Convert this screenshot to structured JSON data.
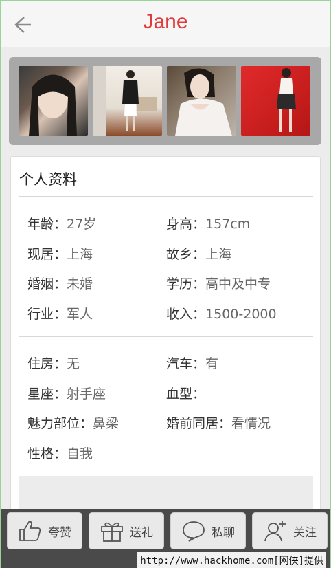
{
  "header": {
    "title": "Jane",
    "back_icon": "back-arrow-icon",
    "accent_color": "#e03a3a"
  },
  "photos": [
    {
      "name": "photo-1"
    },
    {
      "name": "photo-2"
    },
    {
      "name": "photo-3"
    },
    {
      "name": "photo-4"
    }
  ],
  "profile": {
    "section_title": "个人资料",
    "group1": [
      {
        "label": "年龄：",
        "value": "27岁"
      },
      {
        "label": "身高：",
        "value": "157cm"
      },
      {
        "label": "现居：",
        "value": "上海"
      },
      {
        "label": "故乡：",
        "value": "上海"
      },
      {
        "label": "婚姻：",
        "value": "未婚"
      },
      {
        "label": "学历：",
        "value": "高中及中专"
      },
      {
        "label": "行业：",
        "value": "军人"
      },
      {
        "label": "收入：",
        "value": "1500-2000"
      }
    ],
    "group2": [
      {
        "label": "住房：",
        "value": "无"
      },
      {
        "label": "汽车：",
        "value": "有"
      },
      {
        "label": "星座：",
        "value": "射手座"
      },
      {
        "label": "血型：",
        "value": ""
      },
      {
        "label": "魅力部位：",
        "value": "鼻梁"
      },
      {
        "label": "婚前同居：",
        "value": "看情况"
      },
      {
        "label": "性格：",
        "value": "自我"
      }
    ]
  },
  "bottom_bar": {
    "buttons": [
      {
        "label": "夸赞",
        "icon": "thumbs-up-icon"
      },
      {
        "label": "送礼",
        "icon": "gift-icon"
      },
      {
        "label": "私聊",
        "icon": "chat-bubble-icon"
      },
      {
        "label": "关注",
        "icon": "add-user-icon"
      }
    ]
  },
  "watermark": "http://www.hackhome.com[网侠]提供"
}
